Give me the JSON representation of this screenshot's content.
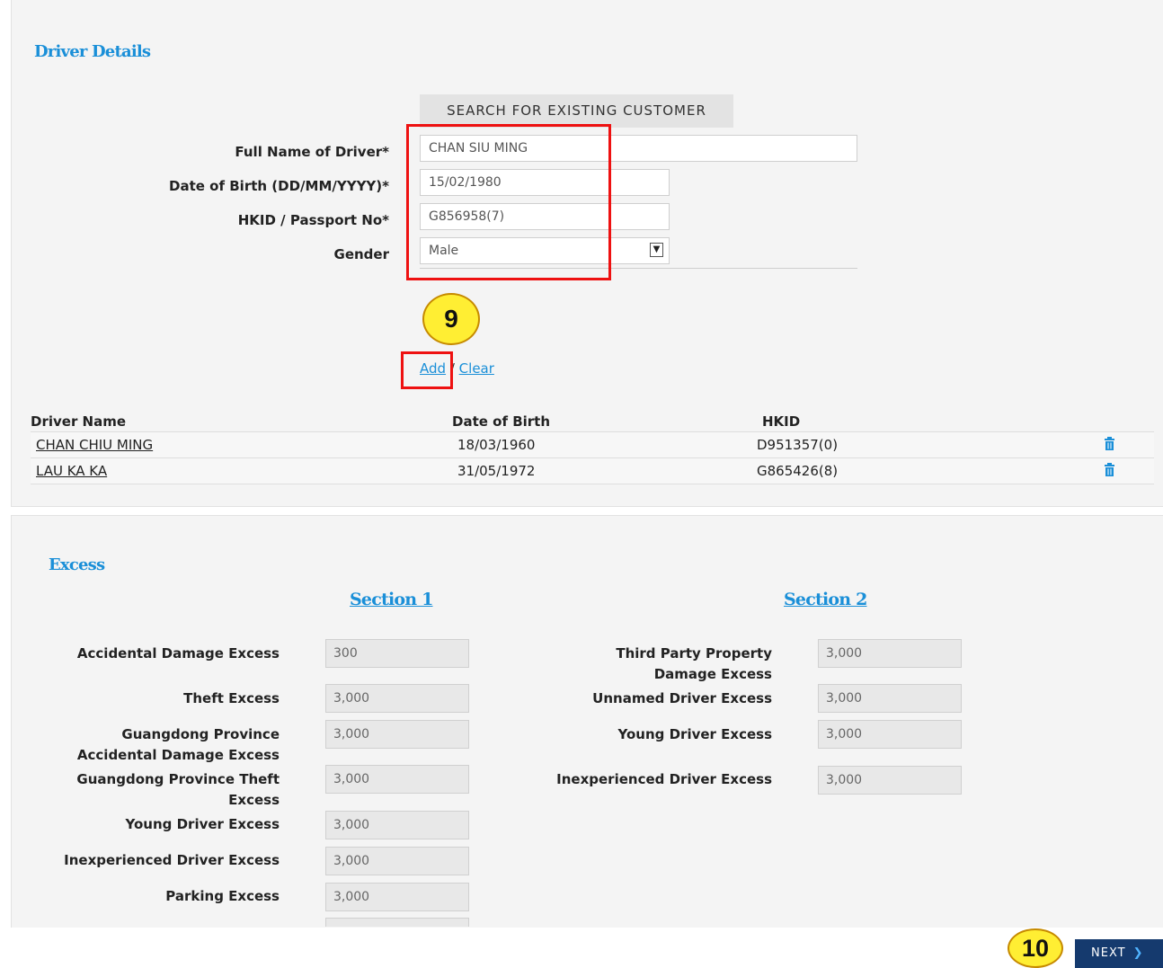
{
  "driver_section": {
    "heading": "Driver Details",
    "search_button": "SEARCH FOR EXISTING CUSTOMER",
    "fields": {
      "full_name": {
        "label": "Full Name of Driver*",
        "value": "CHAN SIU MING"
      },
      "dob": {
        "label": "Date of Birth (DD/MM/YYYY)*",
        "value": "15/02/1980"
      },
      "hkid": {
        "label": "HKID / Passport No*",
        "value": "G856958(7)"
      },
      "gender": {
        "label": "Gender",
        "value": "Male"
      }
    },
    "add_link": "Add",
    "separator": "/",
    "clear_link": "Clear",
    "table": {
      "headers": [
        "Driver Name",
        "Date of Birth",
        "HKID"
      ],
      "rows": [
        {
          "name": "CHAN CHIU MING",
          "dob": "18/03/1960",
          "hkid": "D951357(0)"
        },
        {
          "name": "LAU KA KA",
          "dob": "31/05/1972",
          "hkid": "G865426(8)"
        }
      ]
    }
  },
  "excess_section": {
    "heading": "Excess",
    "section1": {
      "title": "Section 1",
      "items": [
        {
          "label": "Accidental Damage Excess",
          "value": "300"
        },
        {
          "label": "Theft Excess",
          "value": "3,000"
        },
        {
          "label": "Guangdong Province Accidental Damage Excess",
          "value": "3,000"
        },
        {
          "label": "Guangdong Province Theft Excess",
          "value": "3,000"
        },
        {
          "label": "Young Driver Excess",
          "value": "3,000"
        },
        {
          "label": "Inexperienced Driver Excess",
          "value": "3,000"
        },
        {
          "label": "Parking Excess",
          "value": "3,000"
        }
      ]
    },
    "section2": {
      "title": "Section 2",
      "items": [
        {
          "label": "Third Party Property Damage Excess",
          "value": "3,000"
        },
        {
          "label": "Unnamed Driver Excess",
          "value": "3,000"
        },
        {
          "label": "Young Driver Excess",
          "value": "3,000"
        },
        {
          "label": "Inexperienced Driver Excess",
          "value": "3,000"
        }
      ]
    }
  },
  "annotations": {
    "step9": "9",
    "step10": "10"
  },
  "footer": {
    "next_label": "NEXT"
  },
  "colors": {
    "link": "#1a8fd8",
    "highlight": "#e11111",
    "badge": "#ffee33",
    "next_button": "#153a6e"
  }
}
